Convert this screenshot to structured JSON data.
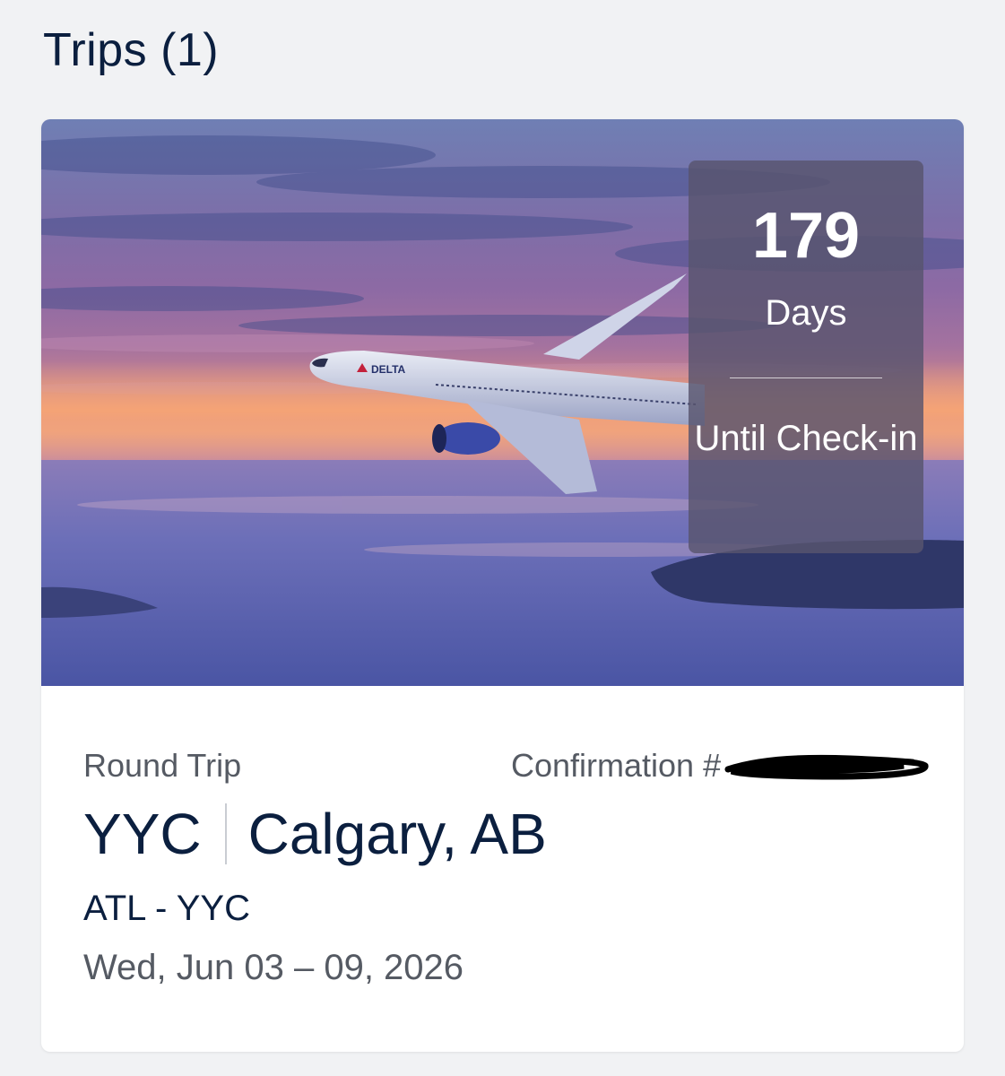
{
  "page": {
    "heading": "Trips (1)"
  },
  "trip": {
    "countdown": {
      "number": "179",
      "unit": "Days",
      "label": "Until Check-in"
    },
    "trip_type": "Round Trip",
    "confirmation_label": "Confirmation #",
    "destination_code": "YYC",
    "destination_city": "Calgary, AB",
    "route": "ATL - YYC",
    "dates": "Wed, Jun 03 – 09, 2026",
    "aircraft_livery": "DELTA"
  },
  "colors": {
    "background": "#f1f2f4",
    "heading_text": "#0b1f3f",
    "secondary_text": "#555a63",
    "countdown_panel": "#58546e"
  }
}
